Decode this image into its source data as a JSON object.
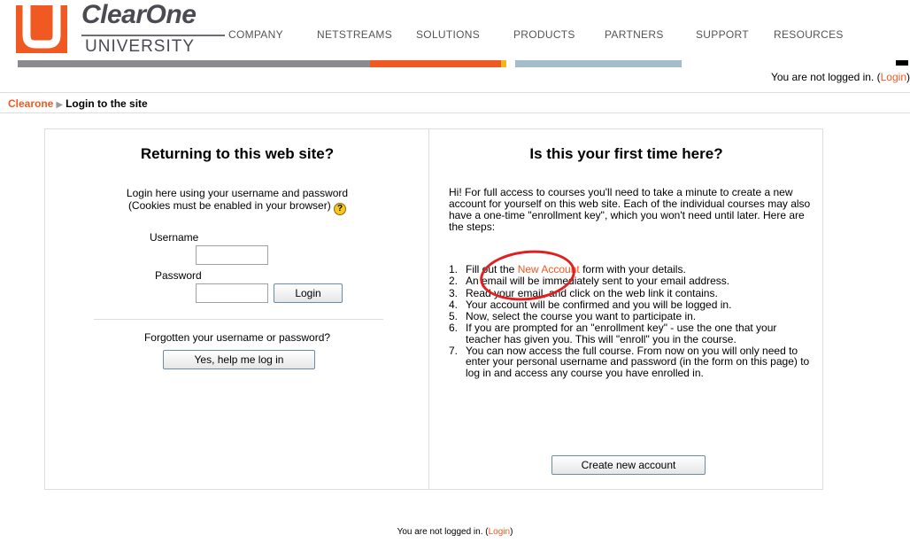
{
  "logo": {
    "mark": "U",
    "brand": "ClearOne",
    "sub": "UNIVERSITY",
    "colors": {
      "orange": "#f05a22",
      "gray": "#4a4a52"
    }
  },
  "nav": {
    "items": [
      "COMPANY",
      "NETSTREAMS",
      "SOLUTIONS",
      "PRODUCTS",
      "PARTNERS",
      "SUPPORT",
      "RESOURCES"
    ]
  },
  "header": {
    "login_status": "You are not logged in.",
    "login_link": "Login"
  },
  "breadcrumb": {
    "home": "Clearone",
    "separator": "▶",
    "current": "Login to the site"
  },
  "login": {
    "title": "Returning to this web site?",
    "desc_line1": "Login here using your username and password",
    "desc_line2": "(Cookies must be enabled in your browser)",
    "help_icon": "?",
    "username_label": "Username",
    "username_value": "",
    "password_label": "Password",
    "password_value": "",
    "login_button": "Login",
    "forgot_text": "Forgotten your username or password?",
    "forgot_button": "Yes, help me log in"
  },
  "signup": {
    "title": "Is this your first time here?",
    "intro": "Hi! For full access to courses you'll need to take a minute to create a new account for yourself on this web site. Each of the individual courses may also have a one-time \"enrollment key\", which you won't need until later. Here are the steps:",
    "step1_pre": "Fill out the ",
    "step1_link": "New Account",
    "step1_post": " form with your details.",
    "steps": [
      "An email will be immediately sent to your email address.",
      "Read your email, and click on the web link it contains.",
      "Your account will be confirmed and you will be logged in.",
      "Now, select the course you want to participate in.",
      "If you are prompted for an \"enrollment key\" - use the one that your teacher has given you. This will \"enroll\" you in the course.",
      "You can now access the full course. From now on you will only need to enter your personal username and password (in the form on this page) to log in and access any course you have enrolled in."
    ],
    "step_numbers": [
      "1.",
      "2.",
      "3.",
      "4.",
      "5.",
      "6.",
      "7."
    ],
    "create_button": "Create new account"
  },
  "footer": {
    "login_status": "You are not logged in.",
    "login_link": "Login"
  },
  "colors": {
    "accent": "#f05a22",
    "border": "#dddddd",
    "annotation": "#e02020"
  }
}
